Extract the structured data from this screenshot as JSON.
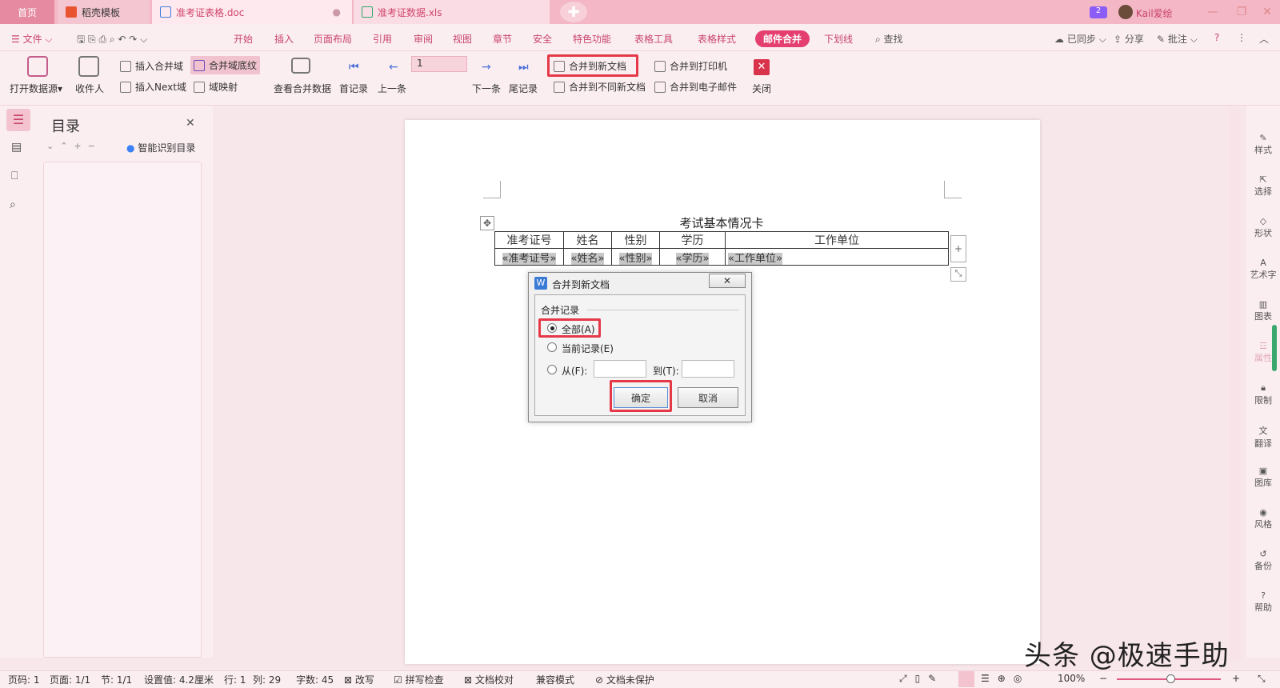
{
  "titlebar": {
    "tabs": [
      {
        "label": "首页"
      },
      {
        "label": "稻壳模板"
      },
      {
        "label": "准考证表格.doc"
      },
      {
        "label": "准考证数据.xls"
      }
    ],
    "badge": "2",
    "user": "Kail爱绘"
  },
  "menubar": {
    "file": "文件",
    "items": [
      "开始",
      "插入",
      "页面布局",
      "引用",
      "审阅",
      "视图",
      "章节",
      "安全",
      "特色功能",
      "表格工具",
      "表格样式",
      "邮件合并",
      "下划线"
    ],
    "find": "查找",
    "sync": "已同步",
    "share": "分享",
    "comment": "批注"
  },
  "ribbon": {
    "open_source": "打开数据源",
    "recipients": "收件人",
    "insert_field": "插入合并域",
    "field_shading": "合并域底纹",
    "insert_next": "插入Next域",
    "field_map": "域映射",
    "view_merged": "查看合并数据",
    "first_record": "首记录",
    "prev": "上一条",
    "record_value": "1",
    "next": "下一条",
    "last_record": "尾记录",
    "merge_new_doc": "合并到新文档",
    "merge_diff_docs": "合并到不同新文档",
    "merge_printer": "合并到打印机",
    "merge_email": "合并到电子邮件",
    "close": "关闭"
  },
  "toc": {
    "title": "目录",
    "smart": "智能识别目录"
  },
  "document": {
    "heading": "考试基本情况卡",
    "headers": [
      "准考证号",
      "姓名",
      "性别",
      "学历",
      "工作单位"
    ],
    "fields": [
      "«准考证号»",
      "«姓名»",
      "«性别»",
      "«学历»",
      "«工作单位»"
    ]
  },
  "dialog": {
    "title": "合并到新文档",
    "group": "合并记录",
    "opt_all": "全部(A)",
    "opt_current": "当前记录(E)",
    "opt_from": "从(F):",
    "opt_to": "到(T):",
    "ok": "确定",
    "cancel": "取消"
  },
  "rightbar": [
    "样式",
    "选择",
    "形状",
    "艺术字",
    "图表",
    "属性",
    "限制",
    "翻译",
    "图库",
    "风格",
    "备份",
    "帮助"
  ],
  "statusbar": {
    "page": "页码: 1",
    "pages": "页面: 1/1",
    "section": "节: 1/1",
    "setting": "设置值: 4.2厘米",
    "row": "行: 1",
    "col": "列: 29",
    "words": "字数: 45",
    "revise": "改写",
    "spell": "拼写检查",
    "proof": "文档校对",
    "compat": "兼容模式",
    "protect": "文档未保护",
    "zoom": "100%"
  },
  "watermark": "头条 @极速手助",
  "colors": {
    "accent": "#e43f6f",
    "highlight": "#e53948",
    "background": "#f7e6ea"
  }
}
